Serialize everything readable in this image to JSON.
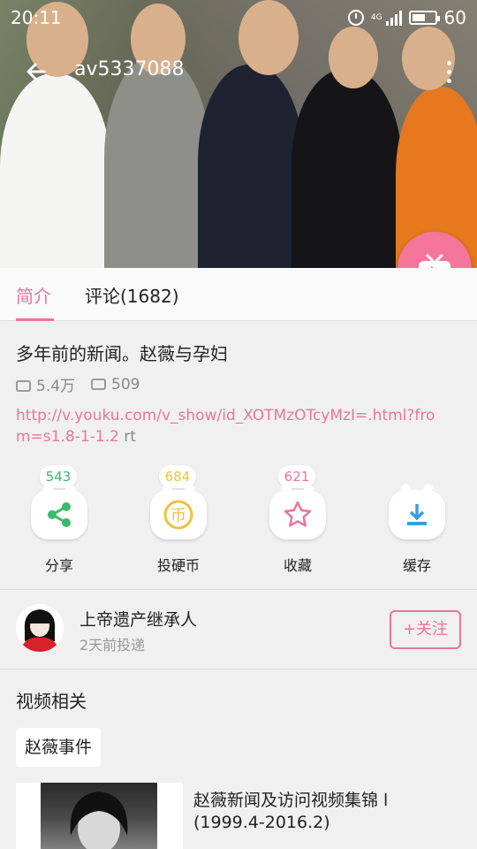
{
  "status": {
    "time": "20:11",
    "network": "4G",
    "battery": "60",
    "battery_fill": 0.6
  },
  "topbar": {
    "title": "av5337088"
  },
  "tabs": [
    {
      "label": "简介"
    },
    {
      "label": "评论(1682)"
    }
  ],
  "video": {
    "title": "多年前的新闻。赵薇与孕妇",
    "plays": "5.4万",
    "danmaku": "509",
    "link": "http://v.youku.com/v_show/id_XOTMzOTcyMzI=.html?from=s1.8-1-1.2",
    "link_suffix": " rt"
  },
  "actions": [
    {
      "label": "分享",
      "count": "543",
      "icon": "share-icon",
      "color": "#3cb96a"
    },
    {
      "label": "投硬币",
      "count": "684",
      "icon": "coin-icon",
      "color": "#f0c13a"
    },
    {
      "label": "收藏",
      "count": "621",
      "icon": "star-icon",
      "color": "#e9759a"
    },
    {
      "label": "缓存",
      "count": "",
      "icon": "download-icon",
      "color": "#3a9de0"
    }
  ],
  "uploader": {
    "name": "上帝遗产继承人",
    "time": "2天前投递",
    "follow_label": "+关注"
  },
  "related": {
    "heading": "视频相关",
    "tag": "赵薇事件",
    "items": [
      {
        "title": "赵薇新闻及访问视频集锦 l (1999.4-2016.2)"
      }
    ]
  },
  "colors": {
    "accent": "#e9759a",
    "fab": "#f4769b"
  }
}
